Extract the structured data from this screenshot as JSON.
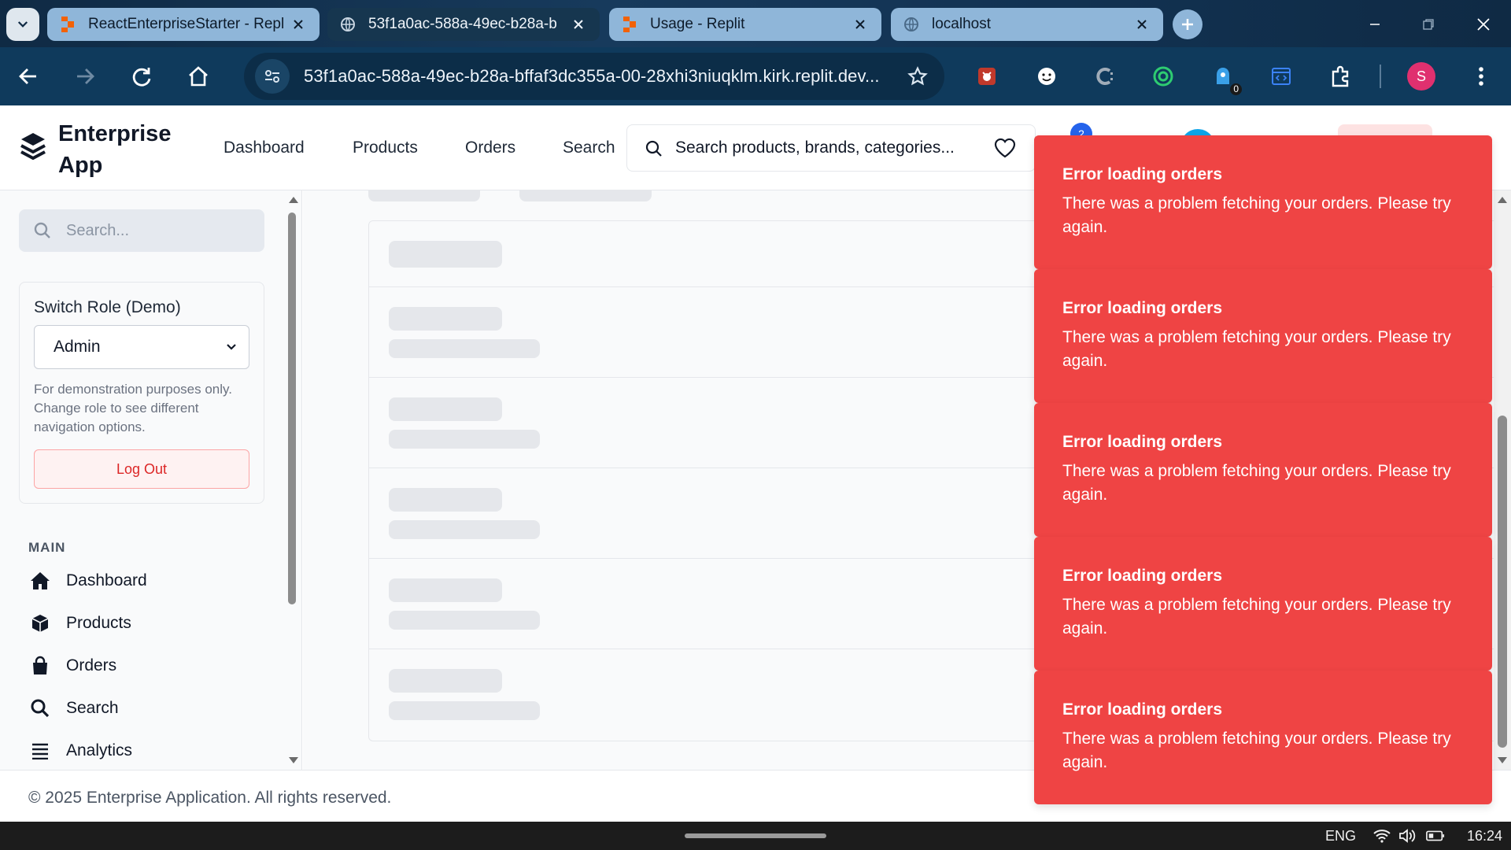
{
  "browser": {
    "tabs": [
      {
        "title": "ReactEnterpriseStarter - Repl",
        "icon": "replit-icon"
      },
      {
        "title": "53f1a0ac-588a-49ec-b28a-b",
        "icon": "globe-icon"
      },
      {
        "title": "Usage - Replit",
        "icon": "replit-icon"
      },
      {
        "title": "localhost",
        "icon": "globe-icon"
      }
    ],
    "url": "53f1a0ac-588a-49ec-b28a-bffaf3dc355a-00-28xhi3niuqklm.kirk.replit.dev...",
    "extension_badge": "0",
    "profile_initial": "S"
  },
  "header": {
    "brand_line1": "Enterprise",
    "brand_line2": "App",
    "nav": [
      "Dashboard",
      "Products",
      "Orders",
      "Search"
    ],
    "search_placeholder": "Search products, brands, categories...",
    "cart_count": "2"
  },
  "sidebar": {
    "search_placeholder": "Search...",
    "role_title": "Switch Role (Demo)",
    "role_selected": "Admin",
    "role_note": "For demonstration purposes only. Change role to see different navigation options.",
    "logout_label": "Log Out",
    "section_label": "MAIN",
    "items": [
      {
        "label": "Dashboard",
        "icon": "home-icon"
      },
      {
        "label": "Products",
        "icon": "cube-icon"
      },
      {
        "label": "Orders",
        "icon": "shopping-bag-icon"
      },
      {
        "label": "Search",
        "icon": "search-icon"
      },
      {
        "label": "Analytics",
        "icon": "list-icon"
      }
    ]
  },
  "footer": {
    "copyright": "© 2025 Enterprise Application. All rights reserved."
  },
  "toasts": [
    {
      "title": "Error loading orders",
      "description": "There was a problem fetching your orders. Please try again."
    },
    {
      "title": "Error loading orders",
      "description": "There was a problem fetching your orders. Please try again."
    },
    {
      "title": "Error loading orders",
      "description": "There was a problem fetching your orders. Please try again."
    },
    {
      "title": "Error loading orders",
      "description": "There was a problem fetching your orders. Please try again."
    },
    {
      "title": "Error loading orders",
      "description": "There was a problem fetching your orders. Please try again."
    }
  ],
  "taskbar": {
    "language": "ENG",
    "time": "16:24"
  },
  "colors": {
    "toast_bg": "#ef4444",
    "accent": "#2563eb",
    "danger": "#dc2626"
  }
}
